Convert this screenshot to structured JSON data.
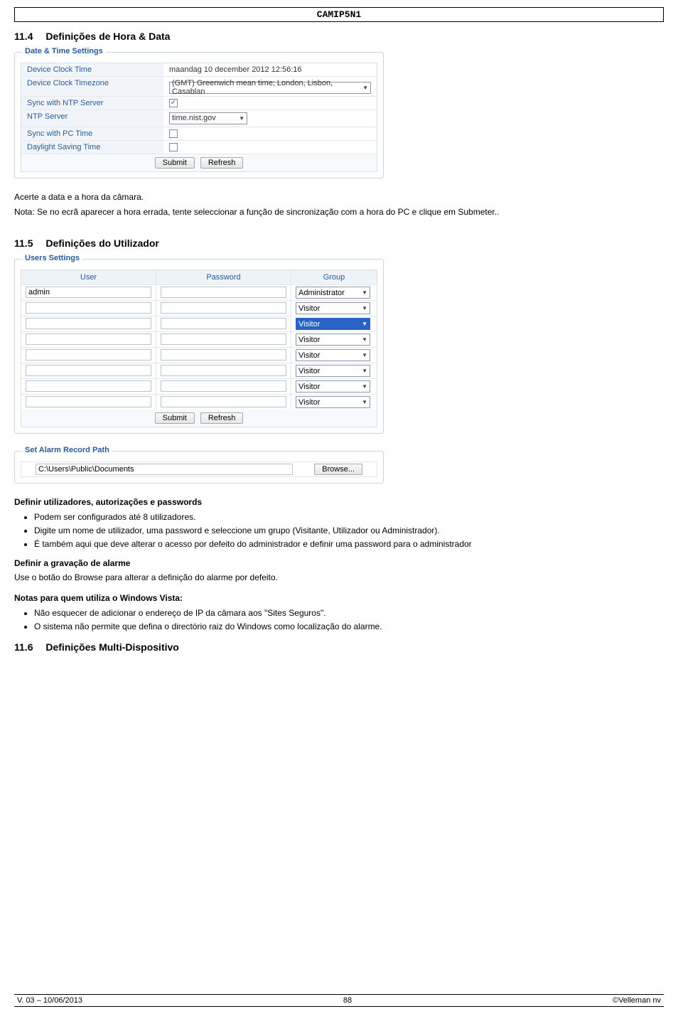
{
  "header": {
    "title": "CAMIP5N1"
  },
  "sections": {
    "s114": {
      "num": "11.4",
      "title": "Definições de Hora & Data"
    },
    "s115": {
      "num": "11.5",
      "title": "Definições do Utilizador"
    },
    "s116": {
      "num": "11.6",
      "title": "Definições Multi-Dispositivo"
    }
  },
  "datetime_fs": {
    "legend": "Date & Time Settings",
    "rows": {
      "clock_time_l": "Device Clock Time",
      "clock_time_v": "maandag 10 december 2012 12:56:16",
      "tz_l": "Device Clock Timezone",
      "tz_v": "(GMT) Greenwich mean time; London, Lisbon, Casablan",
      "sync_ntp_l": "Sync with NTP Server",
      "ntp_server_l": "NTP Server",
      "ntp_server_v": "time.nist.gov",
      "sync_pc_l": "Sync with PC Time",
      "dst_l": "Daylight Saving Time"
    },
    "buttons": {
      "submit": "Submit",
      "refresh": "Refresh"
    }
  },
  "body_text": {
    "acerte": "Acerte a data e a hora da câmara.",
    "nota_clock": "Nota: Se no ecrã aparecer a hora errada, tente seleccionar a função de sincronização com a hora do PC e clique em Submeter..",
    "def_users_h": "Definir utilizadores, autorizações e passwords",
    "def_users_b1": "Podem ser configurados até 8 utilizadores.",
    "def_users_b2": "Digite um nome de utilizador, uma password e seleccione um grupo (Visitante, Utilizador ou Administrador).",
    "def_users_b3": "É também aqui  que deve alterar o acesso por defeito do administrador e definir uma password para o administrador",
    "def_alarm_h": "Definir a gravação de alarme",
    "def_alarm_p": "Use o botão do Browse  para alterar a definição do alarme por defeito.",
    "notas_vista_h": "Notas para quem utiliza o Windows Vista:",
    "notas_vista_b1": "Não esquecer de adicionar o endereço de  IP da câmara aos \"Sites Seguros\".",
    "notas_vista_b2": "O sistema não permite que defina o directório raiz do Windows  como localização do alarme."
  },
  "users_fs": {
    "legend": "Users Settings",
    "headers": {
      "user": "User",
      "password": "Password",
      "group": "Group"
    },
    "rows": [
      {
        "user": "admin",
        "group": "Administrator",
        "hl": false
      },
      {
        "user": "",
        "group": "Visitor",
        "hl": false
      },
      {
        "user": "",
        "group": "Visitor",
        "hl": true
      },
      {
        "user": "",
        "group": "Visitor",
        "hl": false
      },
      {
        "user": "",
        "group": "Visitor",
        "hl": false
      },
      {
        "user": "",
        "group": "Visitor",
        "hl": false
      },
      {
        "user": "",
        "group": "Visitor",
        "hl": false
      },
      {
        "user": "",
        "group": "Visitor",
        "hl": false
      }
    ],
    "buttons": {
      "submit": "Submit",
      "refresh": "Refresh"
    }
  },
  "alarm_path_fs": {
    "legend": "Set Alarm Record Path",
    "path": "C:\\Users\\Public\\Documents",
    "browse": "Browse..."
  },
  "footer": {
    "left": "V. 03 – 10/06/2013",
    "center": "88",
    "right": "©Velleman nv"
  }
}
